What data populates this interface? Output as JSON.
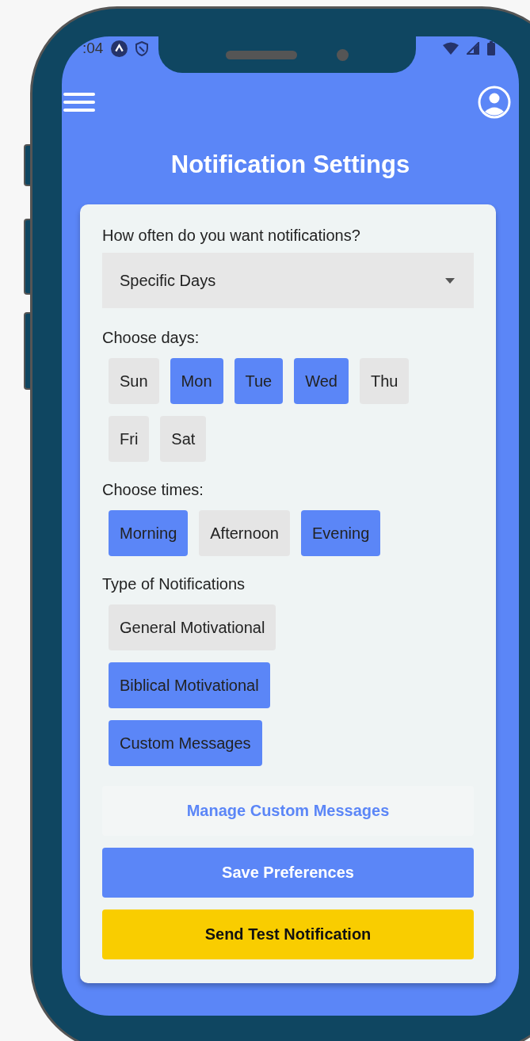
{
  "status_bar": {
    "time": ":04"
  },
  "header": {
    "title": "Notification Settings"
  },
  "frequency": {
    "label": "How often do you want notifications?",
    "value": "Specific Days"
  },
  "days": {
    "label": "Choose days:",
    "options": [
      {
        "label": "Sun",
        "selected": false
      },
      {
        "label": "Mon",
        "selected": true
      },
      {
        "label": "Tue",
        "selected": true
      },
      {
        "label": "Wed",
        "selected": true
      },
      {
        "label": "Thu",
        "selected": false
      },
      {
        "label": "Fri",
        "selected": false
      },
      {
        "label": "Sat",
        "selected": false
      }
    ]
  },
  "times": {
    "label": "Choose times:",
    "options": [
      {
        "label": "Morning",
        "selected": true
      },
      {
        "label": "Afternoon",
        "selected": false
      },
      {
        "label": "Evening",
        "selected": true
      }
    ]
  },
  "types": {
    "label": "Type of Notifications",
    "options": [
      {
        "label": "General Motivational",
        "selected": false
      },
      {
        "label": "Biblical Motivational",
        "selected": true
      },
      {
        "label": "Custom Messages",
        "selected": true
      }
    ]
  },
  "buttons": [
    {
      "label": "Manage Custom Messages",
      "kind": "link"
    },
    {
      "label": "Save Preferences",
      "kind": "primary"
    },
    {
      "label": "Send Test Notification",
      "kind": "warning"
    }
  ]
}
